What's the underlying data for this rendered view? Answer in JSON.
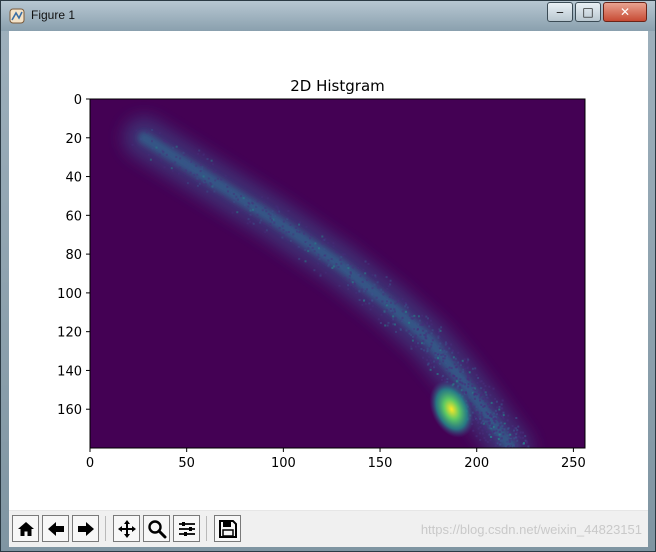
{
  "window": {
    "title": "Figure 1",
    "minimize_glyph": "‒",
    "maximize_glyph": "□",
    "close_glyph": "✕"
  },
  "toolbar": {
    "icons": [
      "home-icon",
      "back-arrow-icon",
      "forward-arrow-icon",
      "pan-icon",
      "zoom-icon",
      "configure-subplots-icon",
      "save-icon"
    ],
    "watermark": "https://blog.csdn.net/weixin_44823151"
  },
  "chart_data": {
    "type": "heatmap",
    "title": "2D Histgram",
    "xlabel": "",
    "ylabel": "",
    "xlim": [
      0,
      256
    ],
    "ylim": [
      180,
      0
    ],
    "x_ticks": [
      0,
      50,
      100,
      150,
      200,
      250
    ],
    "y_ticks": [
      0,
      20,
      40,
      60,
      80,
      100,
      120,
      140,
      160
    ],
    "colormap": "viridis",
    "background_color": "#440154",
    "grid": false,
    "legend": "none",
    "ridge": [
      {
        "x": 28,
        "y": 20,
        "value": 0.05
      },
      {
        "x": 60,
        "y": 40,
        "value": 0.08
      },
      {
        "x": 95,
        "y": 62,
        "value": 0.12
      },
      {
        "x": 130,
        "y": 86,
        "value": 0.16
      },
      {
        "x": 155,
        "y": 106,
        "value": 0.2
      },
      {
        "x": 175,
        "y": 124,
        "value": 0.26
      },
      {
        "x": 190,
        "y": 142,
        "value": 0.34
      },
      {
        "x": 202,
        "y": 158,
        "value": 0.42
      },
      {
        "x": 212,
        "y": 172,
        "value": 0.4
      },
      {
        "x": 218,
        "y": 180,
        "value": 0.34
      }
    ],
    "hotspot": {
      "x": 187,
      "y": 160,
      "value": 1.0
    }
  }
}
